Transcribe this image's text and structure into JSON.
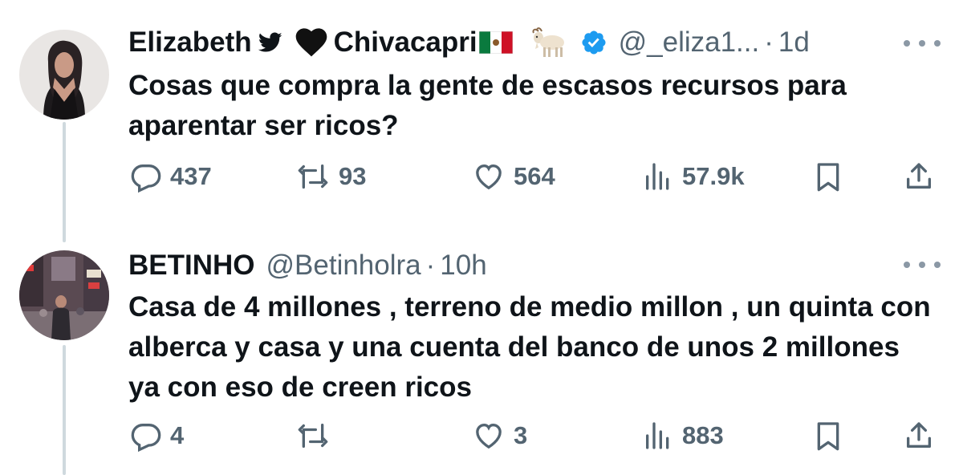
{
  "tweets": [
    {
      "name": "Elizabeth",
      "name_suffix": "Chivacapri",
      "handle": "@_eliza1...",
      "separator": "·",
      "time": "1d",
      "text": "Cosas que compra la gente de escasos recursos para aparentar ser ricos?",
      "stats": {
        "replies": "437",
        "retweets": "93",
        "likes": "564",
        "views": "57.9k"
      },
      "icons": [
        "bird-icon",
        "black-heart-icon",
        "mexico-flag-icon",
        "goat-icon",
        "verified-badge-icon"
      ]
    },
    {
      "name": "BETINHO",
      "handle": "@Betinholra",
      "separator": "·",
      "time": "10h",
      "text": "Casa de 4 millones , terreno de medio millon , un quinta con alberca y casa y una cuenta del banco de unos 2 millones ya con eso de creen ricos",
      "stats": {
        "replies": "4",
        "retweets": "",
        "likes": "3",
        "views": "883"
      }
    }
  ],
  "colors": {
    "text": "#0f1419",
    "secondary": "#536471",
    "verified": "#1d9bf0",
    "thread_line": "#cfd9de"
  }
}
